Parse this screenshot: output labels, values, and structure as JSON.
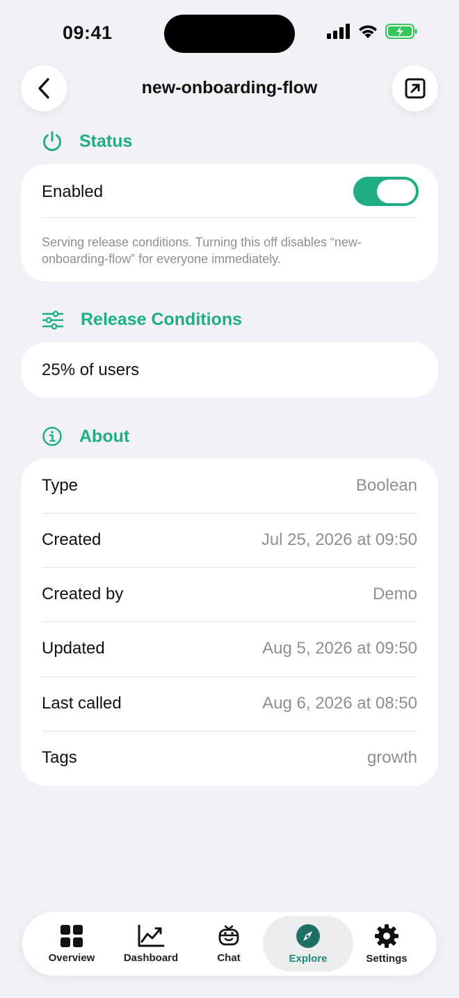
{
  "statusbar": {
    "time": "09:41"
  },
  "nav": {
    "title": "new-onboarding-flow"
  },
  "status": {
    "header": "Status",
    "enabled_label": "Enabled",
    "enabled": true,
    "description": "Serving release conditions. Turning this off disables “new-onboarding-flow” for everyone immediately."
  },
  "release": {
    "header": "Release Conditions",
    "value": "25% of users"
  },
  "about": {
    "header": "About",
    "rows": [
      {
        "label": "Type",
        "value": "Boolean"
      },
      {
        "label": "Created",
        "value": "Jul 25, 2026 at 09:50"
      },
      {
        "label": "Created by",
        "value": "Demo"
      },
      {
        "label": "Updated",
        "value": "Aug 5, 2026 at 09:50"
      },
      {
        "label": "Last called",
        "value": "Aug 6, 2026 at 08:50"
      },
      {
        "label": "Tags",
        "value": "growth"
      }
    ]
  },
  "tabs": [
    {
      "label": "Overview",
      "icon": "grid-icon"
    },
    {
      "label": "Dashboard",
      "icon": "chart-icon"
    },
    {
      "label": "Chat",
      "icon": "robot-icon"
    },
    {
      "label": "Explore",
      "icon": "compass-icon",
      "active": true
    },
    {
      "label": "Settings",
      "icon": "gear-icon"
    }
  ],
  "colors": {
    "accent": "#1fae83",
    "background": "#f2f2f6",
    "active_tab": "#1f8a78"
  }
}
